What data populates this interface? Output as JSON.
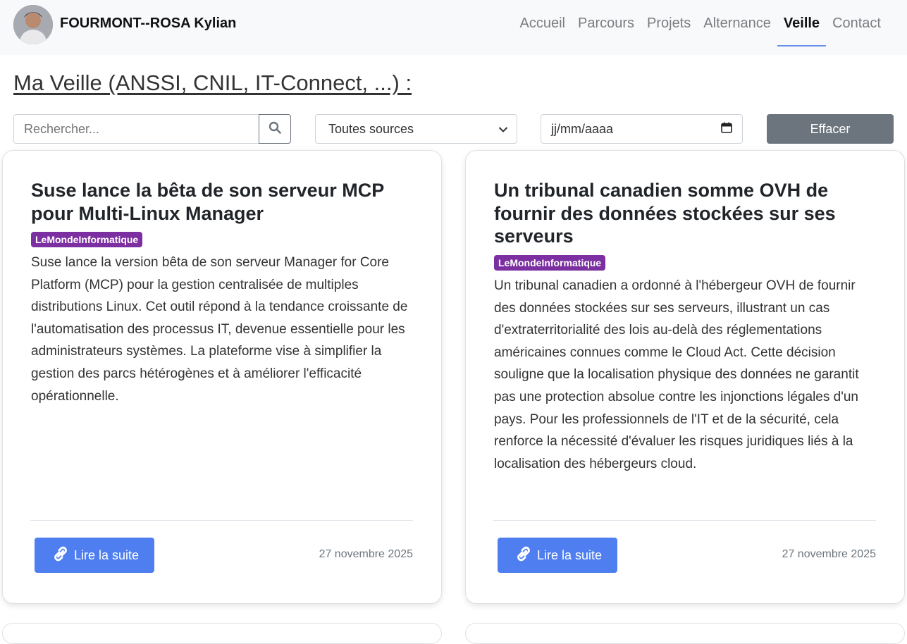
{
  "header": {
    "name": "FOURMONT--ROSA Kylian",
    "nav": [
      "Accueil",
      "Parcours",
      "Projets",
      "Alternance",
      "Veille",
      "Contact"
    ],
    "active": "Veille"
  },
  "page": {
    "title": "Ma Veille (ANSSI, CNIL, IT-Connect, ...) :"
  },
  "filters": {
    "search_placeholder": "Rechercher...",
    "source_selected": "Toutes sources",
    "date_placeholder": "jj/mm/aaaa",
    "clear_label": "Effacer"
  },
  "articles": [
    {
      "title": "Suse lance la bêta de son serveur MCP pour Multi-Linux Manager",
      "source": "LeMondeInformatique",
      "description": "Suse lance la version bêta de son serveur Manager for Core Platform (MCP) pour la gestion centralisée de multiples distributions Linux. Cet outil répond à la tendance croissante de l'automatisation des processus IT, devenue essentielle pour les administrateurs systèmes. La plateforme vise à simplifier la gestion des parcs hétérogènes et à améliorer l'efficacité opérationnelle.",
      "read_more": "Lire la suite",
      "date": "27 novembre 2025"
    },
    {
      "title": "Un tribunal canadien somme OVH de fournir des données stockées sur ses serveurs",
      "source": "LeMondeInformatique",
      "description": "Un tribunal canadien a ordonné à l'hébergeur OVH de fournir des données stockées sur ses serveurs, illustrant un cas d'extraterritorialité des lois au-delà des réglementations américaines connues comme le Cloud Act. Cette décision souligne que la localisation physique des données ne garantit pas une protection absolue contre les injonctions légales d'un pays. Pour les professionnels de l'IT et de la sécurité, cela renforce la nécessité d'évaluer les risques juridiques liés à la localisation des hébergeurs cloud.",
      "read_more": "Lire la suite",
      "date": "27 novembre 2025"
    }
  ],
  "colors": {
    "badge": "#7b2fa0",
    "primary_button": "#4e7ef0",
    "secondary_button": "#6c757d",
    "active_underline": "#6b8ee8"
  },
  "icons": {
    "search": "search-icon",
    "select": "chevron-down-icon",
    "date": "calendar-icon",
    "read_more": "link-icon"
  }
}
